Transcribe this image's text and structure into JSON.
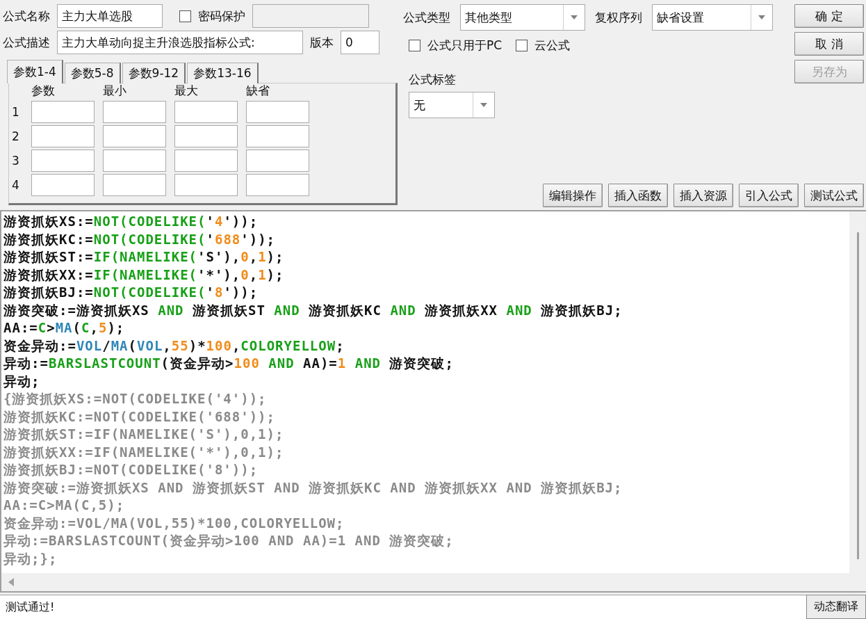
{
  "form": {
    "name_label": "公式名称",
    "name_value": "主力大单选股",
    "password": {
      "label": "密码保护",
      "checked": false
    },
    "description_label": "公式描述",
    "description_value": "主力大单动向捉主升浪选股指标公式:",
    "version_label": "版本",
    "version_value": "0"
  },
  "param_tabs": [
    {
      "label": "参数1-4",
      "selected": true
    },
    {
      "label": "参数5-8",
      "selected": false
    },
    {
      "label": "参数9-12",
      "selected": false
    },
    {
      "label": "参数13-16",
      "selected": false
    }
  ],
  "param_table": {
    "columns": [
      "参数",
      "最小",
      "最大",
      "缺省"
    ],
    "rows": [
      "1",
      "2",
      "3",
      "4"
    ]
  },
  "formula_type": {
    "label": "公式类型",
    "value": "其他类型"
  },
  "rights_series": {
    "label": "复权序列",
    "value": "缺省设置"
  },
  "options": [
    {
      "label": "公式只用于PC",
      "checked": false
    },
    {
      "label": "云公式",
      "checked": false
    }
  ],
  "tag": {
    "label": "公式标签",
    "value": "无"
  },
  "side_buttons": [
    {
      "label": "确 定",
      "disabled": false
    },
    {
      "label": "取 消",
      "disabled": false
    },
    {
      "label": "另存为",
      "disabled": true
    }
  ],
  "tool_buttons": [
    "编辑操作",
    "插入函数",
    "插入资源",
    "引入公式",
    "测试公式"
  ],
  "code_lines": [
    [
      {
        "kind": "plain",
        "text": "游资抓妖XS:="
      },
      {
        "kind": "fn",
        "text": "NOT(CODELIKE("
      },
      {
        "kind": "plain",
        "text": "'"
      },
      {
        "kind": "num",
        "text": "4"
      },
      {
        "kind": "plain",
        "text": "'));"
      }
    ],
    [
      {
        "kind": "plain",
        "text": "游资抓妖KC:="
      },
      {
        "kind": "fn",
        "text": "NOT(CODELIKE("
      },
      {
        "kind": "plain",
        "text": "'"
      },
      {
        "kind": "num",
        "text": "688"
      },
      {
        "kind": "plain",
        "text": "'));"
      }
    ],
    [
      {
        "kind": "plain",
        "text": "游资抓妖ST:="
      },
      {
        "kind": "fn",
        "text": "IF(NAMELIKE("
      },
      {
        "kind": "plain",
        "text": "'S'),"
      },
      {
        "kind": "num",
        "text": "0"
      },
      {
        "kind": "plain",
        "text": ","
      },
      {
        "kind": "num",
        "text": "1"
      },
      {
        "kind": "plain",
        "text": ");"
      }
    ],
    [
      {
        "kind": "plain",
        "text": "游资抓妖XX:="
      },
      {
        "kind": "fn",
        "text": "IF(NAMELIKE("
      },
      {
        "kind": "plain",
        "text": "'*'),"
      },
      {
        "kind": "num",
        "text": "0"
      },
      {
        "kind": "plain",
        "text": ","
      },
      {
        "kind": "num",
        "text": "1"
      },
      {
        "kind": "plain",
        "text": ");"
      }
    ],
    [
      {
        "kind": "plain",
        "text": "游资抓妖BJ:="
      },
      {
        "kind": "fn",
        "text": "NOT(CODELIKE("
      },
      {
        "kind": "plain",
        "text": "'"
      },
      {
        "kind": "num",
        "text": "8"
      },
      {
        "kind": "plain",
        "text": "'));"
      }
    ],
    [
      {
        "kind": "plain",
        "text": "游资突破:=游资抓妖XS "
      },
      {
        "kind": "fn",
        "text": "AND"
      },
      {
        "kind": "plain",
        "text": " 游资抓妖ST "
      },
      {
        "kind": "fn",
        "text": "AND"
      },
      {
        "kind": "plain",
        "text": " 游资抓妖KC "
      },
      {
        "kind": "fn",
        "text": "AND"
      },
      {
        "kind": "plain",
        "text": " 游资抓妖XX "
      },
      {
        "kind": "fn",
        "text": "AND"
      },
      {
        "kind": "plain",
        "text": " 游资抓妖BJ;"
      }
    ],
    [
      {
        "kind": "plain",
        "text": "AA:="
      },
      {
        "kind": "fn",
        "text": "C"
      },
      {
        "kind": "plain",
        "text": ">"
      },
      {
        "kind": "sys",
        "text": "MA"
      },
      {
        "kind": "plain",
        "text": "("
      },
      {
        "kind": "fn",
        "text": "C"
      },
      {
        "kind": "plain",
        "text": ","
      },
      {
        "kind": "num",
        "text": "5"
      },
      {
        "kind": "plain",
        "text": ");"
      }
    ],
    [
      {
        "kind": "plain",
        "text": "资金异动:="
      },
      {
        "kind": "sys",
        "text": "VOL"
      },
      {
        "kind": "plain",
        "text": "/"
      },
      {
        "kind": "sys",
        "text": "MA"
      },
      {
        "kind": "plain",
        "text": "("
      },
      {
        "kind": "sys",
        "text": "VOL"
      },
      {
        "kind": "plain",
        "text": ","
      },
      {
        "kind": "num",
        "text": "55"
      },
      {
        "kind": "plain",
        "text": ")*"
      },
      {
        "kind": "num",
        "text": "100"
      },
      {
        "kind": "plain",
        "text": ","
      },
      {
        "kind": "fn",
        "text": "COLORYELLOW"
      },
      {
        "kind": "plain",
        "text": ";"
      }
    ],
    [
      {
        "kind": "plain",
        "text": "异动:="
      },
      {
        "kind": "fn",
        "text": "BARSLASTCOUNT"
      },
      {
        "kind": "plain",
        "text": "(资金异动>"
      },
      {
        "kind": "num",
        "text": "100"
      },
      {
        "kind": "fn",
        "text": " AND"
      },
      {
        "kind": "plain",
        "text": " AA)="
      },
      {
        "kind": "num",
        "text": "1"
      },
      {
        "kind": "fn",
        "text": " AND"
      },
      {
        "kind": "plain",
        "text": " 游资突破;"
      }
    ],
    [
      {
        "kind": "plain",
        "text": "异动;"
      }
    ],
    [
      {
        "kind": "comment",
        "text": "{游资抓妖XS:=NOT(CODELIKE('4'));"
      }
    ],
    [
      {
        "kind": "comment",
        "text": "游资抓妖KC:=NOT(CODELIKE('688'));"
      }
    ],
    [
      {
        "kind": "comment",
        "text": "游资抓妖ST:=IF(NAMELIKE('S'),0,1);"
      }
    ],
    [
      {
        "kind": "comment",
        "text": "游资抓妖XX:=IF(NAMELIKE('*'),0,1);"
      }
    ],
    [
      {
        "kind": "comment",
        "text": "游资抓妖BJ:=NOT(CODELIKE('8'));"
      }
    ],
    [
      {
        "kind": "comment",
        "text": "游资突破:=游资抓妖XS AND 游资抓妖ST AND 游资抓妖KC AND 游资抓妖XX AND 游资抓妖BJ;"
      }
    ],
    [
      {
        "kind": "comment",
        "text": "AA:=C>MA(C,5);"
      }
    ],
    [
      {
        "kind": "comment",
        "text": "资金异动:=VOL/MA(VOL,55)*100,COLORYELLOW;"
      }
    ],
    [
      {
        "kind": "comment",
        "text": "异动:=BARSLASTCOUNT(资金异动>100 AND AA)=1 AND 游资突破;"
      }
    ],
    [
      {
        "kind": "comment",
        "text": "异动;};"
      }
    ]
  ],
  "status": {
    "message": "测试通过!",
    "button": "动态翻译"
  }
}
